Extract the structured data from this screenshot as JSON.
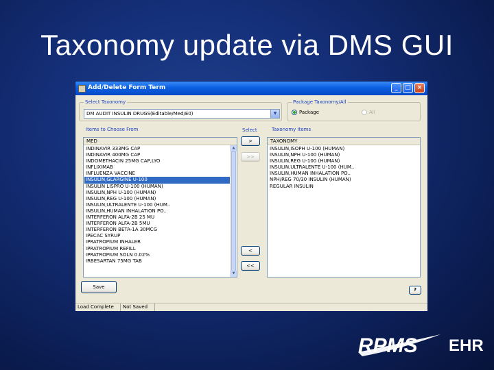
{
  "slide": {
    "title": "Taxonomy update via DMS GUI"
  },
  "window": {
    "title": "Add/Delete Form Term",
    "controls": {
      "minimize": "_",
      "maximize": "□",
      "close": "×"
    }
  },
  "select_taxonomy": {
    "label": "Select Taxonomy",
    "value": "DM AUDIT INSULIN DRUGS(Editable/Med/E0)"
  },
  "package_taxonomy": {
    "label": "Package Taxonomy/All",
    "options": [
      {
        "label": "Package",
        "selected": true
      },
      {
        "label": "All",
        "selected": false
      }
    ]
  },
  "items_to_choose": {
    "label": "Items to Choose From",
    "column": "MED",
    "selected_index": 5,
    "items": [
      "INDINAVIR 333MG CAP",
      "INDINAVIR 400MG CAP",
      "INDOMETHACIN 25MG CAP,LYO",
      "INFLIXIMAB",
      "INFLUENZA VACCINE",
      "INSULIN,GLARGINE U-100",
      "INSULIN LISPRO U-100 (HUMAN)",
      "INSULIN,NPH U-100 (HUMAN)",
      "INSULIN,REG U-100 (HUMAN)",
      "INSULIN,ULTRALENTE U-100 (HUM..",
      "INSULIN,HUMAN INHALATION PO..",
      "INTERFERON ALFA-2B 25 MU",
      "INTERFERON ALFA-2B 5MU",
      "INTERFERON BETA-1A 30MCG",
      "IPECAC SYRUP",
      "IPRATROPIUM INHALER",
      "IPRATROPIUM REFILL",
      "IPRATROPIUM SOLN 0.02%",
      "IRBESARTAN 75MG TAB"
    ]
  },
  "select_buttons": {
    "label": "Select",
    "add": ">",
    "add_all": ">>",
    "remove": "<",
    "remove_all": "<<"
  },
  "taxonomy_items": {
    "label": "Taxonomy Items",
    "column": "TAXONOMY",
    "items": [
      "INSULIN,ISOPH U-100 (HUMAN)",
      "INSULIN,NPH U-100 (HUMAN)",
      "INSULIN,REG U-100 (HUMAN)",
      "INSULIN,ULTRALENTE U-100 (HUM..",
      "INSULIN,HUMAN INHALATION PO..",
      "NPH/REG 70/30 INSULIN (HUMAN)",
      "REGULAR INSULIN"
    ]
  },
  "buttons": {
    "save": "Save",
    "help": "?"
  },
  "status": {
    "load": "Load Complete",
    "save": "Not Saved"
  },
  "logo": {
    "text": "RPMS",
    "suffix": "EHR"
  }
}
